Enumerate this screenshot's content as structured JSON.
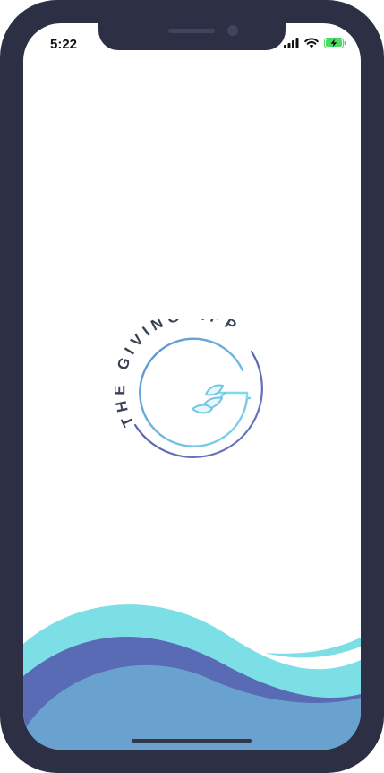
{
  "status_bar": {
    "time": "5:22",
    "icons": [
      "signal-icon",
      "wifi-icon",
      "battery-charging-icon"
    ],
    "battery_color": "#4cd964"
  },
  "logo": {
    "text": "THE GIVING APP",
    "icon": "sprout-icon",
    "colors": {
      "text": "#3b4256",
      "ring_start": "#5a67b8",
      "ring_end": "#7dd3e8"
    }
  },
  "waves": {
    "colors": [
      "#7ddfe6",
      "#5a6bb5",
      "#6aa2cf"
    ]
  },
  "frame_color": "#2d2f45"
}
